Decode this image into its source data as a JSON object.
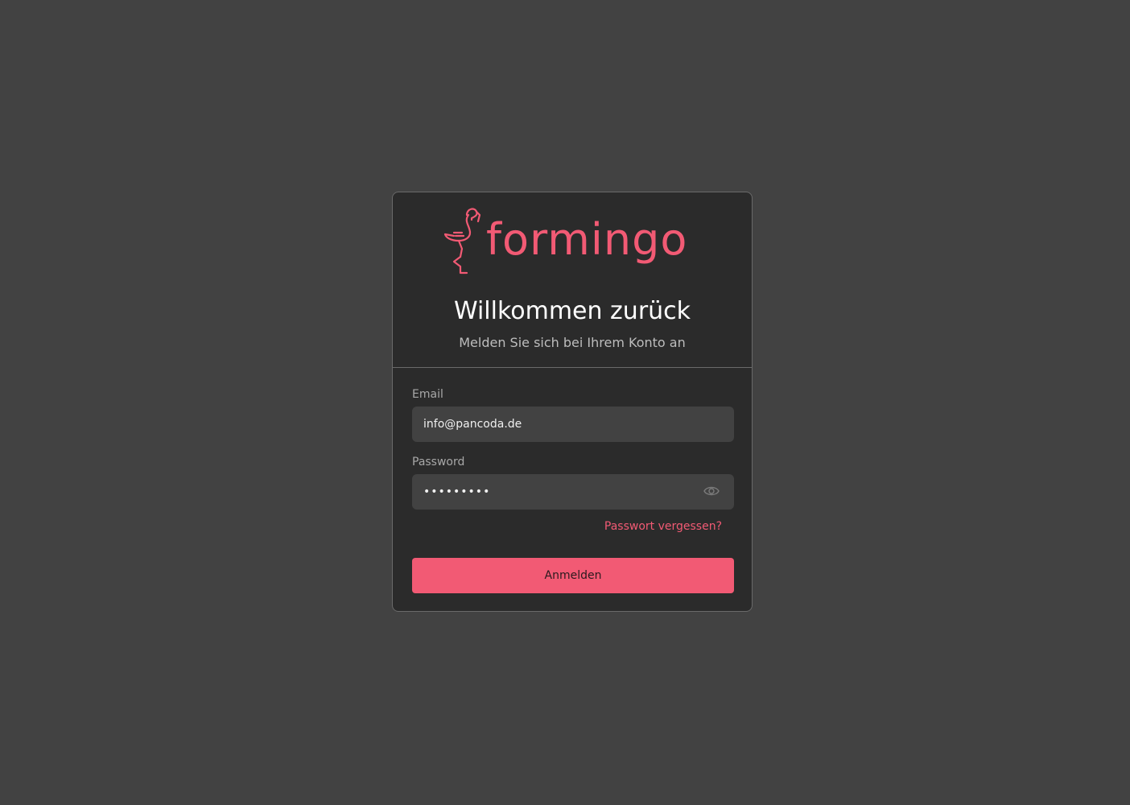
{
  "brand": {
    "name": "formingo",
    "color": "#f25a74"
  },
  "header": {
    "title": "Willkommen zurück",
    "subtitle": "Melden Sie sich bei Ihrem Konto an"
  },
  "form": {
    "email_label": "Email",
    "email_value": "info@pancoda.de",
    "password_label": "Password",
    "password_value": "•••••••••",
    "forgot_link": "Passwort vergessen?",
    "submit_label": "Anmelden",
    "toggle_icon": "eye-icon"
  }
}
